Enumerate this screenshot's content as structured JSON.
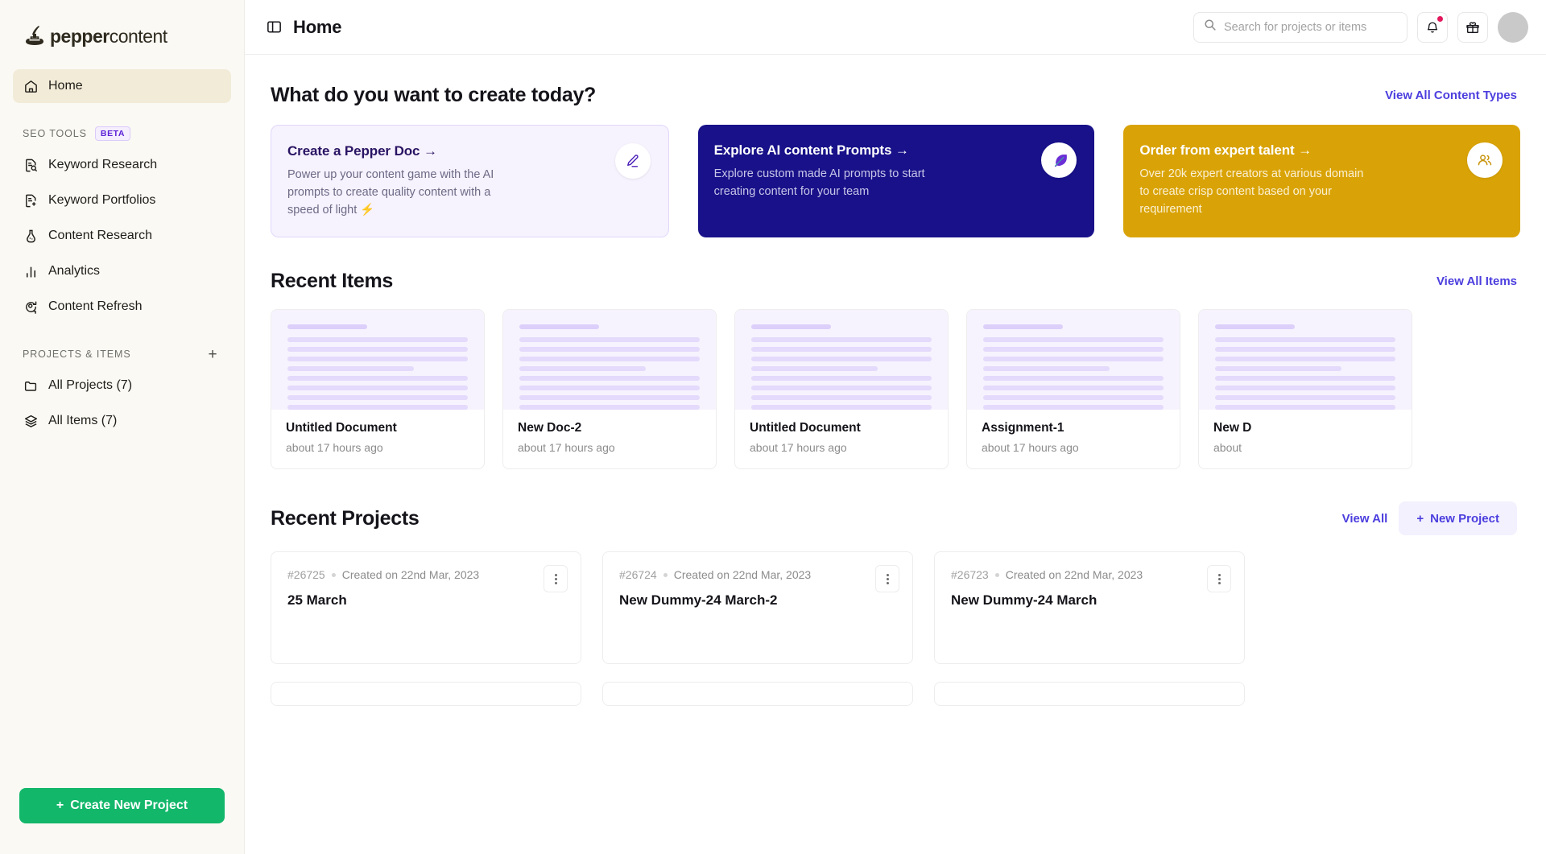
{
  "brand": {
    "name_bold": "pepper",
    "name_light": "content",
    "logo_icon": "ink-pot-quill-icon"
  },
  "sidebar": {
    "home": {
      "label": "Home",
      "icon": "home-icon"
    },
    "seo_section": {
      "title": "SEO TOOLS",
      "badge": "BETA"
    },
    "seo_items": [
      {
        "label": "Keyword Research",
        "icon": "document-search-icon"
      },
      {
        "label": "Keyword Portfolios",
        "icon": "document-plus-icon"
      },
      {
        "label": "Content Research",
        "icon": "flask-icon"
      },
      {
        "label": "Analytics",
        "icon": "bar-chart-icon"
      },
      {
        "label": "Content Refresh",
        "icon": "refresh-icon"
      }
    ],
    "projects_section": {
      "title": "PROJECTS & ITEMS",
      "add_icon": "plus-icon"
    },
    "project_items": [
      {
        "label": "All Projects (7)",
        "icon": "folder-icon"
      },
      {
        "label": "All Items (7)",
        "icon": "layers-icon"
      }
    ],
    "create_button": {
      "label": "Create New Project",
      "icon": "plus-icon",
      "color": "#12B76A"
    }
  },
  "topbar": {
    "panel_icon": "sidebar-toggle-icon",
    "title": "Home",
    "search": {
      "placeholder": "Search for projects or items",
      "icon": "search-icon"
    },
    "notifications": {
      "icon": "bell-icon",
      "has_unread": true,
      "badge_color": "#E3175B"
    },
    "gift": {
      "icon": "gift-icon"
    },
    "avatar": {
      "icon": "avatar-icon"
    }
  },
  "create_section": {
    "heading": "What do you want to create today?",
    "view_all_link": "View All Content Types",
    "cards": [
      {
        "title": "Create a Pepper Doc →",
        "desc": "Power up your content game with the AI prompts to create quality content with a speed of light ⚡",
        "badge_icon": "pencil-icon",
        "theme": "purple",
        "bg": "#F6F2FE"
      },
      {
        "title": "Explore AI content Prompts →",
        "desc": "Explore custom made AI prompts to start creating content for your team",
        "badge_icon": "feather-icon",
        "theme": "navy",
        "bg": "#181189"
      },
      {
        "title": "Order from expert talent →",
        "desc": "Over 20k expert creators at various domain to create crisp content based on your requirement",
        "badge_icon": "people-icon",
        "theme": "gold",
        "bg": "#D9A307"
      }
    ]
  },
  "recent_items": {
    "heading": "Recent Items",
    "view_all_link": "View All Items",
    "items": [
      {
        "title": "Untitled Document",
        "meta": "about 17 hours ago"
      },
      {
        "title": "New Doc-2",
        "meta": "about 17 hours ago"
      },
      {
        "title": "Untitled Document",
        "meta": "about 17 hours ago"
      },
      {
        "title": "Assignment-1",
        "meta": "about 17 hours ago"
      },
      {
        "title": "New D",
        "meta": "about"
      }
    ]
  },
  "recent_projects": {
    "heading": "Recent Projects",
    "view_all_link": "View All",
    "new_project_button": {
      "label": "New Project",
      "icon": "plus-icon"
    },
    "projects": [
      {
        "id": "#26725",
        "created": "Created on 22nd Mar, 2023",
        "title": "25 March",
        "menu_icon": "kebab-menu-icon"
      },
      {
        "id": "#26724",
        "created": "Created on 22nd Mar, 2023",
        "title": "New Dummy-24 March-2",
        "menu_icon": "kebab-menu-icon"
      },
      {
        "id": "#26723",
        "created": "Created on 22nd Mar, 2023",
        "title": "New Dummy-24 March",
        "menu_icon": "kebab-menu-icon"
      }
    ]
  }
}
